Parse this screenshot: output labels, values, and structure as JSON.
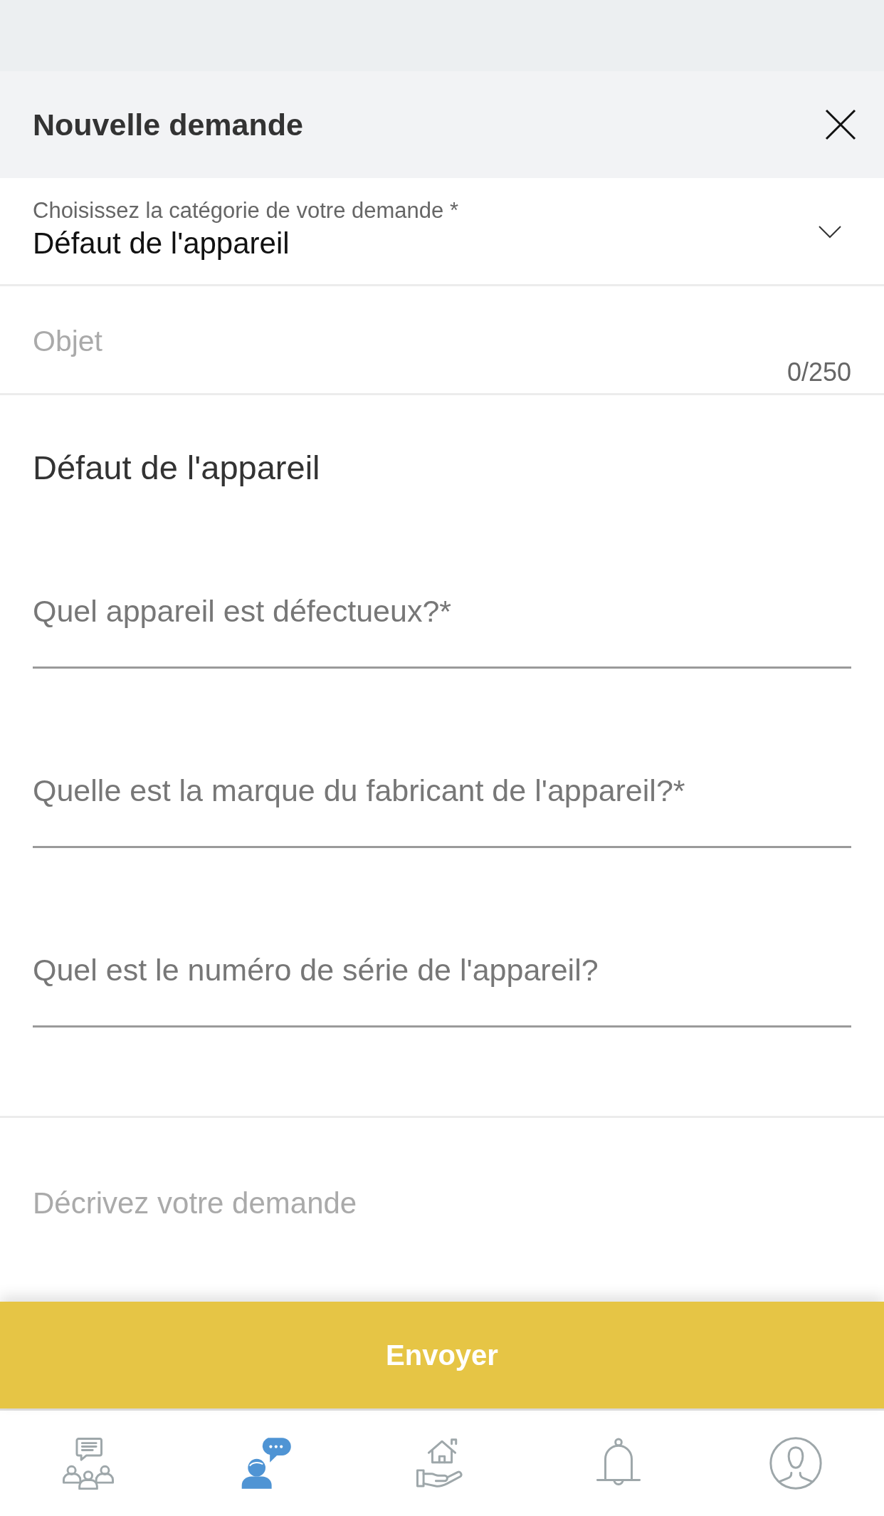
{
  "header": {
    "title": "Nouvelle demande"
  },
  "category_select": {
    "label": "Choisissez la catégorie de votre demande *",
    "value": "Défaut de l'appareil"
  },
  "subject_field": {
    "placeholder": "Objet",
    "counter": "0/250"
  },
  "form_section": {
    "title": "Défaut de l'appareil",
    "fields": [
      {
        "placeholder": "Quel appareil est défectueux?*"
      },
      {
        "placeholder": "Quelle est la marque du fabricant de l'appareil?*"
      },
      {
        "placeholder": "Quel est le numéro de série de l'appareil?"
      }
    ]
  },
  "description_field": {
    "placeholder": "Décrivez votre demande"
  },
  "submit_button": {
    "label": "Envoyer"
  },
  "tab_bar": {
    "items": [
      {
        "kind": "group",
        "selected": false
      },
      {
        "kind": "support",
        "selected": true
      },
      {
        "kind": "home",
        "selected": false
      },
      {
        "kind": "bell",
        "selected": false
      },
      {
        "kind": "account",
        "selected": false
      }
    ]
  }
}
